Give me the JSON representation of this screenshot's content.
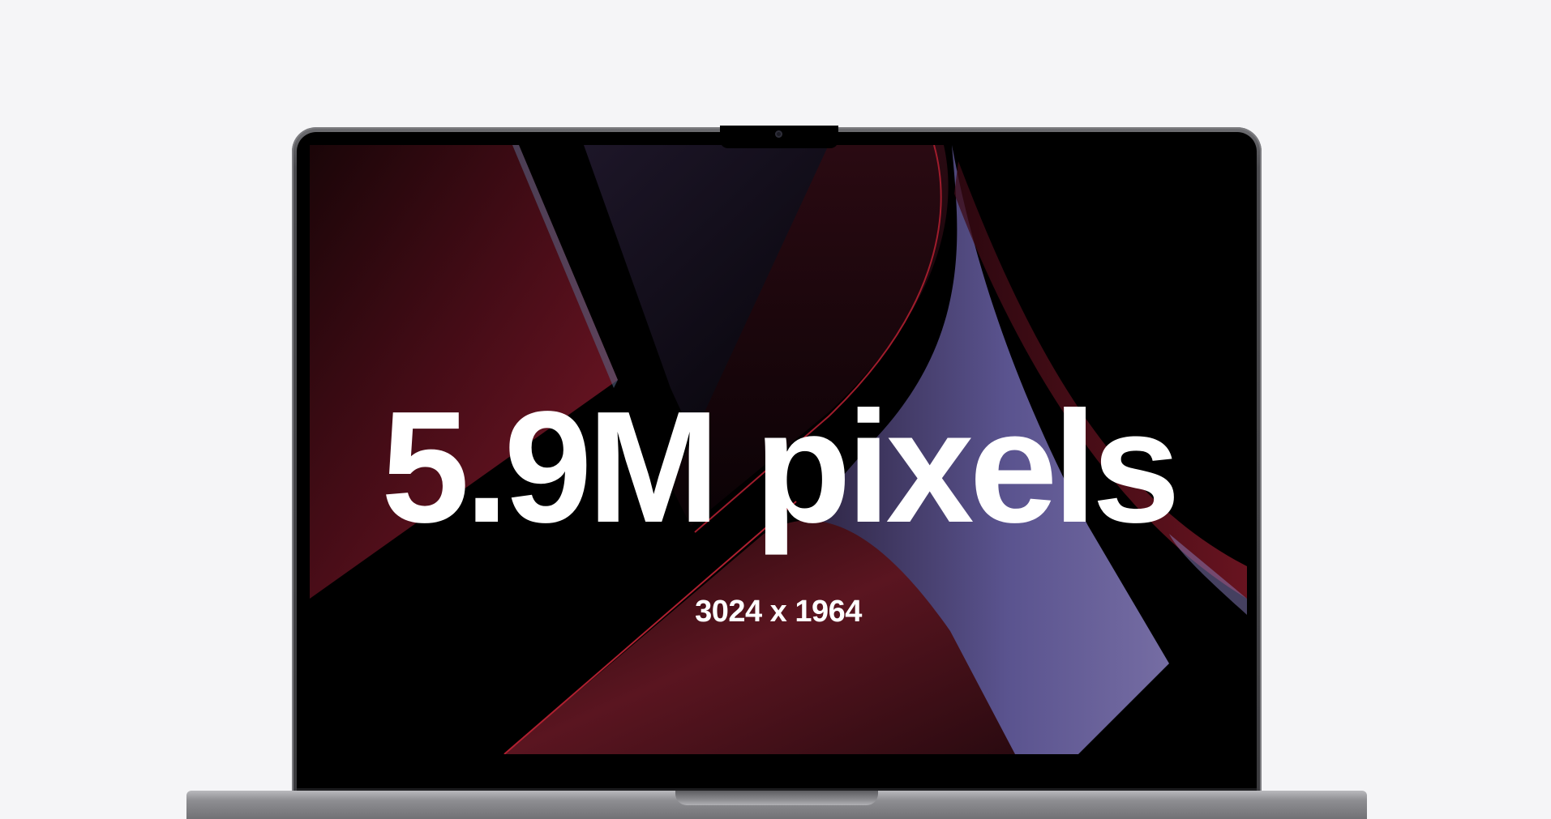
{
  "display": {
    "headline": "5.9M pixels",
    "resolution": "3024 x 1964"
  },
  "colors": {
    "page_background": "#f5f5f7",
    "text": "#ffffff",
    "wallpaper_red": "#5a0f1c",
    "wallpaper_violet": "#6a62a8"
  }
}
